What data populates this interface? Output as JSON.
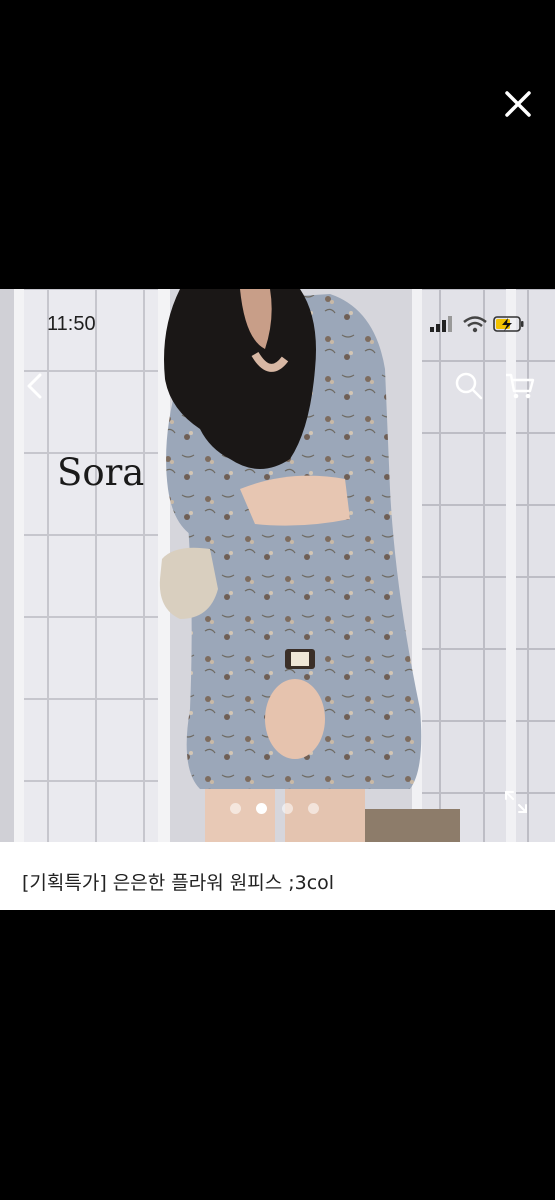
{
  "viewer": {
    "close_icon": "close-icon"
  },
  "photo": {
    "status_bar": {
      "time": "11:50",
      "icons": [
        "cellular-signal-icon",
        "wifi-icon",
        "battery-charging-icon"
      ]
    },
    "nav": {
      "back_icon": "chevron-left-icon",
      "search_icon": "search-icon",
      "cart_icon": "cart-icon"
    },
    "brand_text": "Sora",
    "carousel": {
      "total": 4,
      "active_index": 1
    },
    "expand_icon": "expand-icon"
  },
  "caption": {
    "title": "[기획특가] 은은한 플라워 원피스 ;3col"
  },
  "colors": {
    "background": "#000000",
    "dress": "#9aa6b8",
    "screen_panel": "#e9e9ee",
    "caption_bg": "#ffffff"
  }
}
